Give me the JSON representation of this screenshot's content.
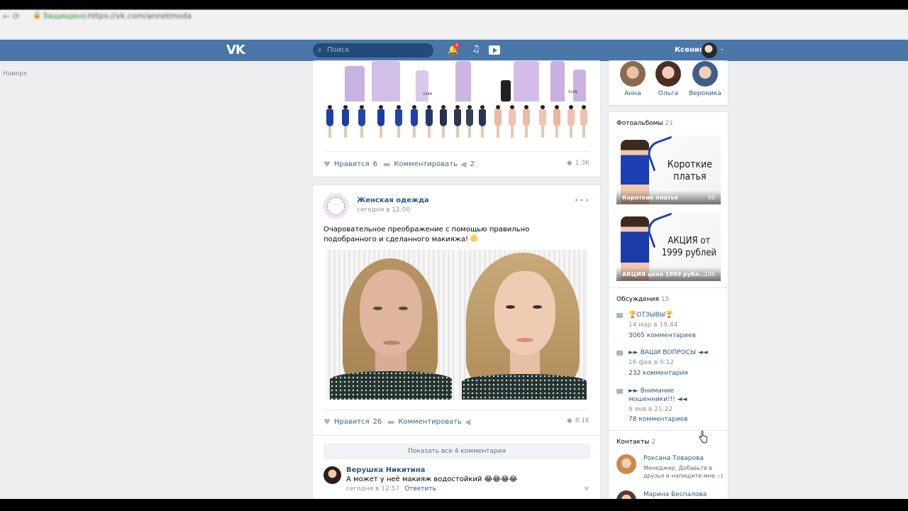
{
  "browser": {
    "security_label": "Защищено",
    "url": "https://vk.com/annetmoda"
  },
  "header": {
    "logo": "VK",
    "search_placeholder": "Поиск",
    "notification_count": "4",
    "user_name": "Ксения"
  },
  "left": {
    "back_to_top": "Наверх"
  },
  "post1": {
    "catalog_codes": [
      "Х144",
      "Х146"
    ],
    "like_label": "Нравится",
    "like_count": "6",
    "comment_label": "Комментировать",
    "share_count": "2",
    "views": "1.3K"
  },
  "post2": {
    "group_name": "Женская одежда",
    "time": "сегодня в 12:00",
    "text": "Очаровательное преображение с помощью правильно подобранного и сделанного макияжа!",
    "like_label": "Нравится",
    "like_count": "26",
    "comment_label": "Комментировать",
    "views": "8.1K",
    "show_all_comments": "Показать все 4 комментария",
    "comment": {
      "author": "Верушка Никитина",
      "text": "А может у неё макияж водостойкий 😂😂😂😂",
      "time": "сегодня в 12:57",
      "reply": "Ответить"
    }
  },
  "friends": {
    "items": [
      {
        "name": "Анна"
      },
      {
        "name": "Ольга"
      },
      {
        "name": "Вероника"
      }
    ]
  },
  "albums": {
    "title": "Фотоальбомы",
    "count": "21",
    "items": [
      {
        "heading_line1": "Короткие",
        "heading_line2": "платья",
        "caption": "Короткие платья",
        "count": "50"
      },
      {
        "heading_line1": "АКЦИЯ от",
        "heading_line2": "1999 рублей",
        "caption": "АКЦИЯ цена 1999 рубл...",
        "count": "106"
      }
    ]
  },
  "discussions": {
    "title": "Обсуждения",
    "count": "15",
    "items": [
      {
        "title": "🏆ОТЗЫВЫ🏆",
        "date": "14 мар в 19:44",
        "comments": "3065 комментариев"
      },
      {
        "title": "►► ВАШИ ВОПРОСЫ ◄◄",
        "date": "16 фев в 9:12",
        "comments": "232 комментария"
      },
      {
        "title": "►► Внимание мошенники!!! ◄◄",
        "date": "9 янв в 21:22",
        "comments": "78 комментариев"
      }
    ]
  },
  "contacts": {
    "title": "Контакты",
    "count": "2",
    "items": [
      {
        "name": "Роксана Товарова",
        "desc": "Менеджер. Добавьте в друзья и напишите мне :-)"
      },
      {
        "name": "Марина Беспалова",
        "desc": ""
      }
    ]
  },
  "colors": {
    "header_bg": "#4a76a8",
    "page_bg": "#edeef0",
    "link": "#2a5885",
    "album_accent": "#1a3fb0"
  }
}
